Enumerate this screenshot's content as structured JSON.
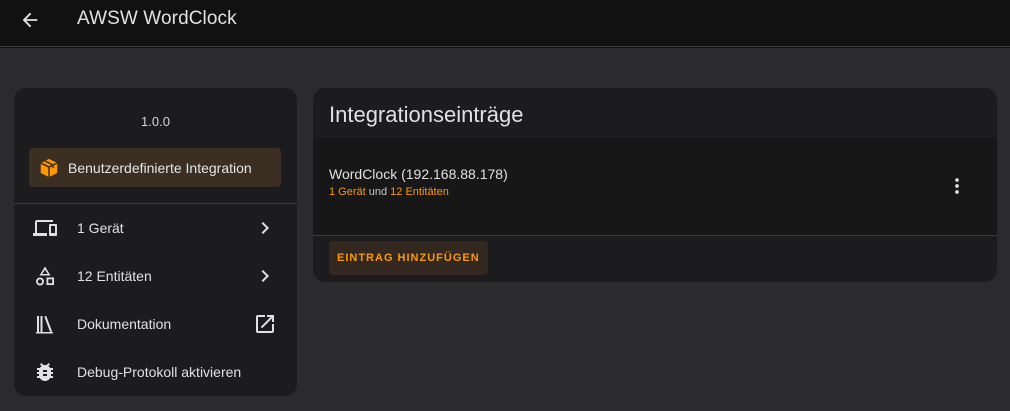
{
  "header": {
    "back_icon": "arrow-left-icon",
    "title": "AWSW WordClock"
  },
  "colors": {
    "accent": "#ff9800",
    "card": "#1c1c1e",
    "background": "#2b2b2e"
  },
  "sidebar": {
    "version": "1.0.0",
    "custom_integration": {
      "icon": "package-icon",
      "label": "Benutzerdefinierte Integration"
    },
    "items": [
      {
        "icon": "devices-icon",
        "label": "1 Gerät",
        "trailing": "chevron-right-icon"
      },
      {
        "icon": "shapes-icon",
        "label": "12 Entitäten",
        "trailing": "chevron-right-icon"
      },
      {
        "icon": "bookshelf-icon",
        "label": "Dokumentation",
        "trailing": "open-in-new-icon"
      },
      {
        "icon": "bug-icon",
        "label": "Debug-Protokoll aktivieren",
        "trailing": ""
      }
    ]
  },
  "main": {
    "title": "Integrationseinträge",
    "entry": {
      "name": "WordClock (192.168.88.178)",
      "devices_link": "1 Gerät",
      "conjunction": "und",
      "entities_link": "12 Entitäten",
      "menu_icon": "dots-vertical-icon"
    },
    "add_button": "EINTRAG HINZUFÜGEN"
  }
}
